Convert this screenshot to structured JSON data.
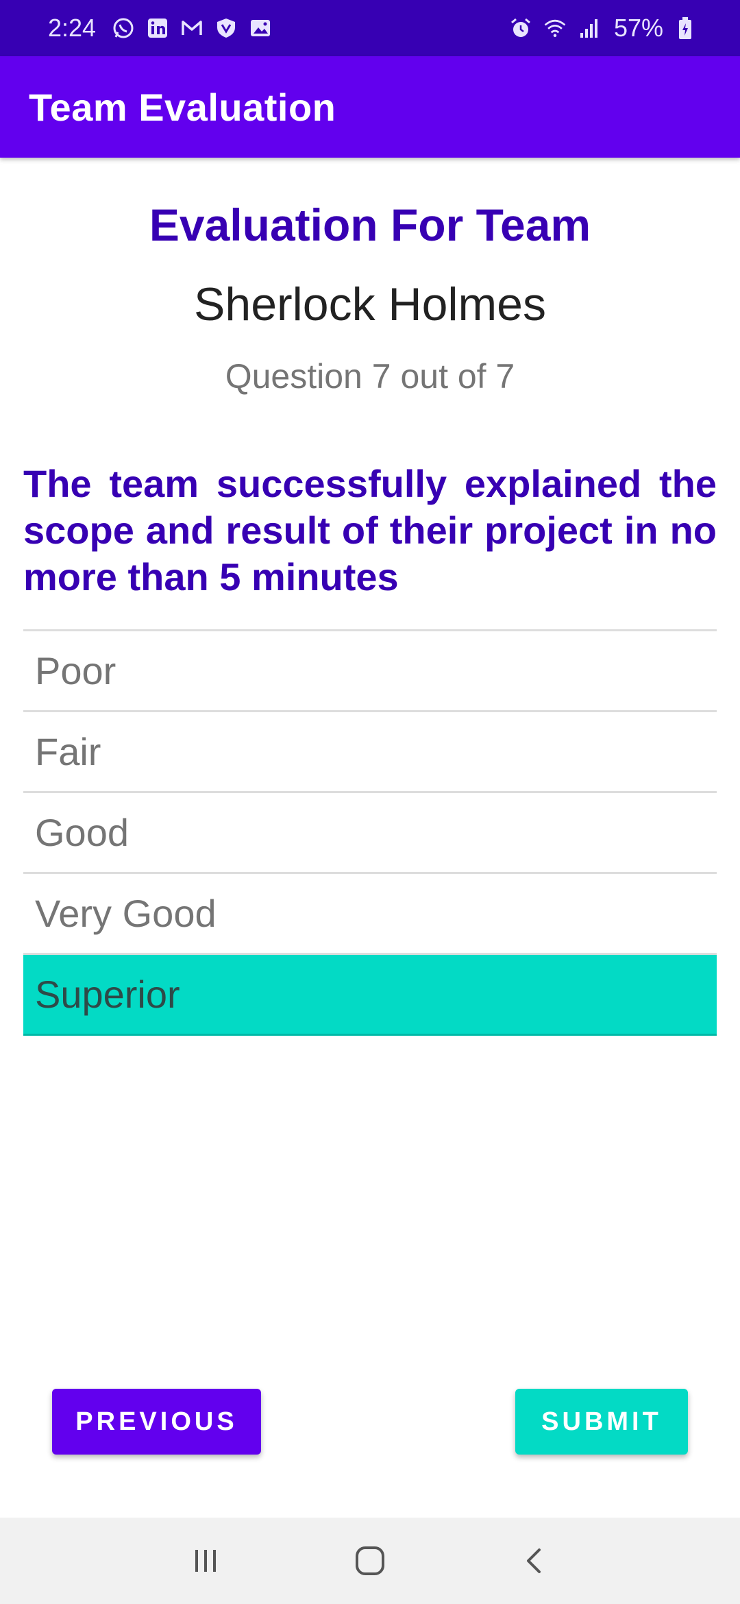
{
  "status_bar": {
    "time": "2:24",
    "battery": "57%",
    "left_icons": [
      "whatsapp-icon",
      "linkedin-icon",
      "gmail-icon",
      "vpn-shield-icon",
      "gallery-icon"
    ],
    "right_icons": [
      "alarm-icon",
      "wifi-icon",
      "signal-icon",
      "battery-icon"
    ]
  },
  "app_bar": {
    "title": "Team Evaluation"
  },
  "evaluation": {
    "heading": "Evaluation For Team",
    "team_name": "Sherlock Holmes",
    "counter": "Question 7 out of 7",
    "question": "The team successfully explained the scope and result of their project in no more than 5 minutes"
  },
  "options": [
    {
      "label": "Poor",
      "selected": false
    },
    {
      "label": "Fair",
      "selected": false
    },
    {
      "label": "Good",
      "selected": false
    },
    {
      "label": "Very Good",
      "selected": false
    },
    {
      "label": "Superior",
      "selected": true
    }
  ],
  "buttons": {
    "previous": "PREVIOUS",
    "submit": "SUBMIT"
  },
  "nav_bar": {
    "icons": [
      "recent-apps-icon",
      "home-icon",
      "back-icon"
    ]
  },
  "colors": {
    "status_bar": "#3700b3",
    "app_bar": "#6200ee",
    "primary_text": "#3700b3",
    "selected_option": "#03dac5",
    "submit_button": "#03dac5",
    "previous_button": "#6200ee"
  }
}
